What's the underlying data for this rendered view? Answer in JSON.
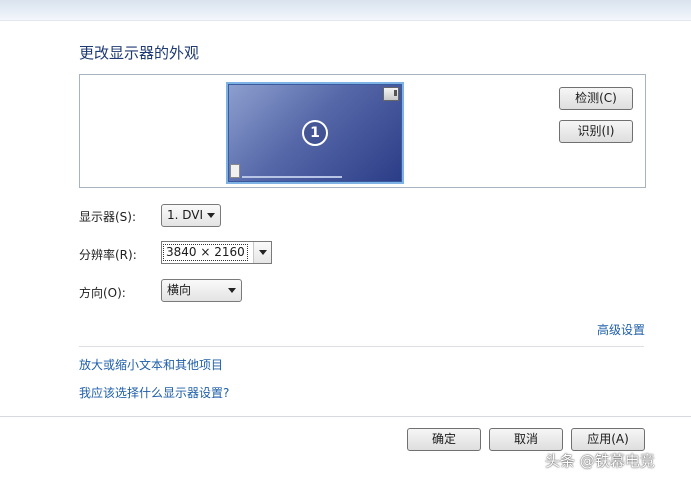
{
  "title": "更改显示器的外观",
  "preview": {
    "monitor_number": "1",
    "detect_label": "检测(C)",
    "identify_label": "识别(I)"
  },
  "settings": {
    "display_label": "显示器(S):",
    "display_value": "1. DVI",
    "resolution_label": "分辨率(R):",
    "resolution_value": "3840 × 2160",
    "orientation_label": "方向(O):",
    "orientation_value": "横向"
  },
  "links": {
    "advanced": "高级设置",
    "text_size": "放大或缩小文本和其他项目",
    "which_settings": "我应该选择什么显示器设置?"
  },
  "footer": {
    "ok_label": "确定",
    "cancel_label": "取消",
    "apply_label": "应用(A)"
  },
  "watermark": "头条 @铁幕电竞"
}
